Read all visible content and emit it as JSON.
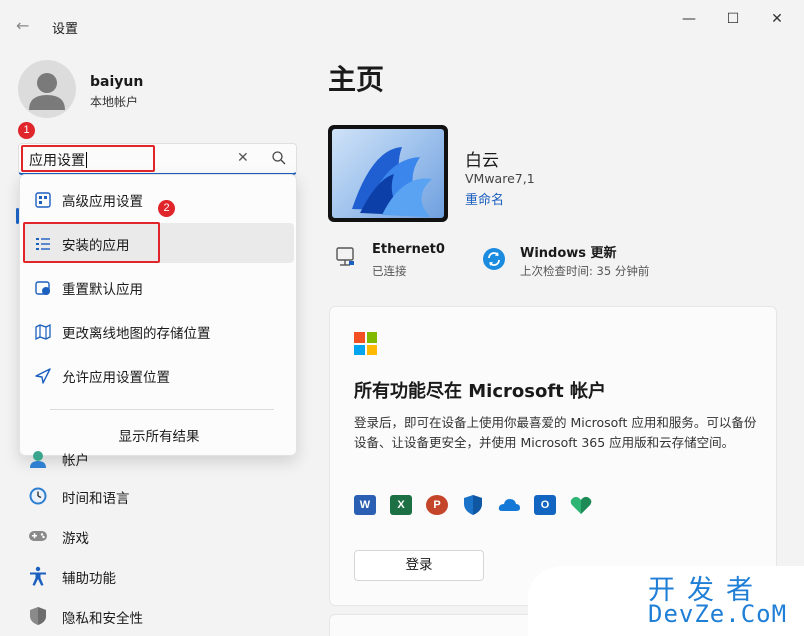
{
  "window": {
    "title": "设置",
    "back_glyph": "←",
    "minimize_glyph": "—",
    "maximize_glyph": "☐",
    "close_glyph": "✕"
  },
  "user": {
    "name": "baiyun",
    "account_type": "本地帐户"
  },
  "annotations": {
    "step1": "1",
    "step2": "2",
    "color": "#e0252b"
  },
  "search": {
    "value": "应用设置",
    "clear_glyph": "✕"
  },
  "dropdown": {
    "items": [
      {
        "label": "高级应用设置",
        "icon": "advanced-apps-icon"
      },
      {
        "label": "安装的应用",
        "icon": "installed-apps-icon",
        "selected": true
      },
      {
        "label": "重置默认应用",
        "icon": "default-apps-icon"
      },
      {
        "label": "更改离线地图的存储位置",
        "icon": "offline-maps-icon"
      },
      {
        "label": "允许应用设置位置",
        "icon": "location-icon"
      }
    ],
    "footer": "显示所有结果"
  },
  "sidebar": {
    "items": [
      {
        "label": "帐户",
        "icon": "accounts-icon"
      },
      {
        "label": "时间和语言",
        "icon": "time-language-icon"
      },
      {
        "label": "游戏",
        "icon": "gaming-icon"
      },
      {
        "label": "辅助功能",
        "icon": "accessibility-icon"
      },
      {
        "label": "隐私和安全性",
        "icon": "privacy-shield-icon"
      }
    ]
  },
  "main": {
    "title": "主页",
    "device": {
      "name": "白云",
      "model": "VMware7,1",
      "rename": "重命名"
    },
    "status": {
      "network": {
        "title": "Ethernet0",
        "sub": "已连接"
      },
      "update": {
        "title": "Windows 更新",
        "sub": "上次检查时间: 35 分钟前"
      }
    },
    "ms_card": {
      "heading": "所有功能尽在 Microsoft 帐户",
      "description": "登录后，即可在设备上使用你最喜爱的 Microsoft 应用和服务。可以备份设备、让设备更安全，并使用 Microsoft 365 应用版和云存储空间。",
      "apps": [
        {
          "name": "word-icon",
          "letter": "W",
          "color": "#2b5fb4"
        },
        {
          "name": "excel-icon",
          "letter": "X",
          "color": "#1d7044"
        },
        {
          "name": "powerpoint-icon",
          "letter": "P",
          "color": "#c4452a"
        },
        {
          "name": "defender-icon",
          "letter": "",
          "color": "#1a73c9"
        },
        {
          "name": "onedrive-icon",
          "letter": "",
          "color": "#1479d6"
        },
        {
          "name": "outlook-icon",
          "letter": "O",
          "color": "#1266c2"
        },
        {
          "name": "family-icon",
          "letter": "",
          "color": "#2fb573"
        }
      ],
      "signin": "登录"
    }
  },
  "watermark": {
    "top": "开发者",
    "bottom": "DevZe.CoM"
  },
  "colors": {
    "accent": "#1b5fbf",
    "highlight": "#e0252b"
  }
}
